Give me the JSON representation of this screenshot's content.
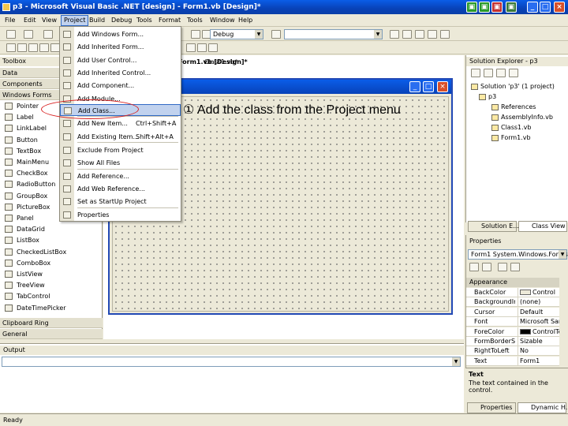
{
  "window": {
    "title": "p3 - Microsoft Visual Basic .NET [design] - Form1.vb [Design]*",
    "controls": [
      "minimize-icon",
      "maximize-icon",
      "close-icon"
    ]
  },
  "menubar": [
    "File",
    "Edit",
    "View",
    "Project",
    "Build",
    "Debug",
    "Tools",
    "Format",
    "Tools",
    "Window",
    "Help"
  ],
  "toolbar2": {
    "config_value": "Debug"
  },
  "doc_tabs": [
    "Form1.vb [Design]*",
    "Class1.vb*"
  ],
  "toolbox": {
    "header": "Toolbox",
    "sections_top": [
      "Data",
      "Components",
      "Windows Forms"
    ],
    "items": [
      "Pointer",
      "Label",
      "LinkLabel",
      "Button",
      "TextBox",
      "MainMenu",
      "CheckBox",
      "RadioButton",
      "GroupBox",
      "PictureBox",
      "Panel",
      "DataGrid",
      "ListBox",
      "CheckedListBox",
      "ComboBox",
      "ListView",
      "TreeView",
      "TabControl",
      "DateTimePicker"
    ],
    "sections_bottom": [
      "Clipboard Ring",
      "General"
    ]
  },
  "project_menu": {
    "items": [
      {
        "label": "Add Windows Form...",
        "shortcut": ""
      },
      {
        "label": "Add Inherited Form...",
        "shortcut": ""
      },
      {
        "label": "Add User Control...",
        "shortcut": ""
      },
      {
        "label": "Add Inherited Control...",
        "shortcut": ""
      },
      {
        "label": "Add Component...",
        "shortcut": ""
      },
      {
        "label": "Add Module...",
        "shortcut": ""
      },
      {
        "label": "Add Class...",
        "shortcut": ""
      },
      {
        "label": "Add New Item...",
        "shortcut": "Ctrl+Shift+A"
      },
      {
        "label": "Add Existing Item...",
        "shortcut": "Shift+Alt+A"
      },
      {
        "label": "Exclude From Project",
        "shortcut": ""
      },
      {
        "label": "Show All Files",
        "shortcut": ""
      },
      {
        "label": "Add Reference...",
        "shortcut": ""
      },
      {
        "label": "Add Web Reference...",
        "shortcut": ""
      },
      {
        "label": "Set as StartUp Project",
        "shortcut": ""
      },
      {
        "label": "Properties",
        "shortcut": ""
      }
    ],
    "highlighted_index": 6
  },
  "annotation": "① Add the class from the Project menu",
  "solution_explorer": {
    "header": "Solution Explorer - p3",
    "nodes": [
      "Solution 'p3' (1 project)",
      "p3",
      "References",
      "AssemblyInfo.vb",
      "Class1.vb",
      "Form1.vb"
    ],
    "tabs": [
      "Solution E...",
      "Class View"
    ]
  },
  "properties": {
    "header": "Properties",
    "object": "Form1 System.Windows.Forms",
    "category": "Appearance",
    "rows": [
      {
        "name": "BackColor",
        "value": "Control"
      },
      {
        "name": "BackgroundIm",
        "value": "(none)"
      },
      {
        "name": "Cursor",
        "value": "Default"
      },
      {
        "name": "Font",
        "value": "Microsoft Sans"
      },
      {
        "name": "ForeColor",
        "value": "ControlTe"
      },
      {
        "name": "FormBorderS",
        "value": "Sizable"
      },
      {
        "name": "RightToLeft",
        "value": "No"
      },
      {
        "name": "Text",
        "value": "Form1"
      }
    ],
    "desc_title": "Text",
    "desc_text": "The text contained in the control.",
    "tabs": [
      "Properties",
      "Dynamic H..."
    ]
  },
  "output": {
    "header": "Output"
  },
  "status": "Ready",
  "colors": {
    "accent": "#316ac5",
    "titlebar": "#0a5de8",
    "annotation_circle": "#d82020"
  }
}
